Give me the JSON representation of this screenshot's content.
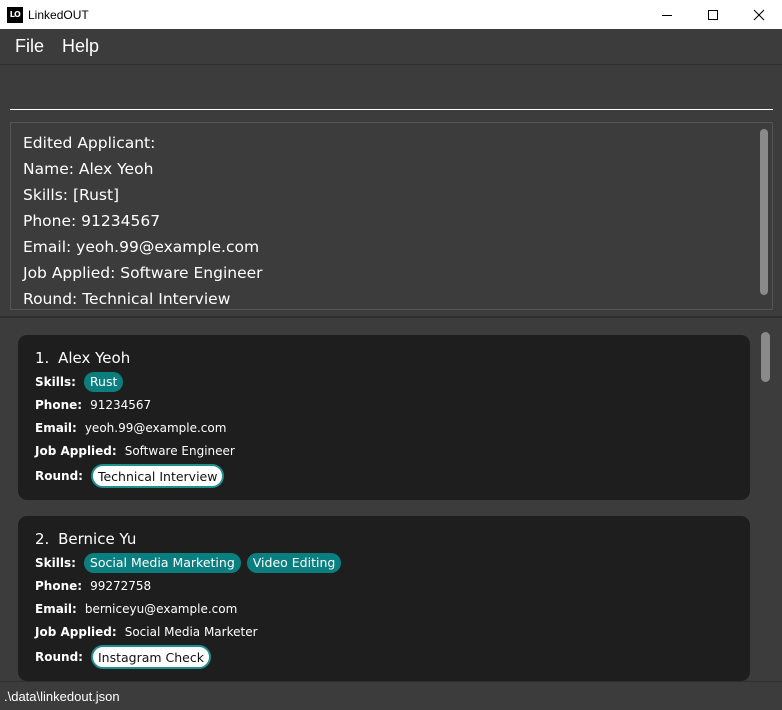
{
  "window": {
    "title": "LinkedOUT",
    "icon_text": "LO"
  },
  "menu": {
    "items": [
      "File",
      "Help"
    ]
  },
  "command": {
    "value": "",
    "placeholder": ""
  },
  "result": {
    "lines": [
      "Edited Applicant:",
      "Name: Alex Yeoh",
      "Skills: [Rust]",
      "Phone: 91234567",
      "Email: yeoh.99@example.com",
      "Job Applied: Software Engineer",
      "Round: Technical Interview"
    ]
  },
  "labels": {
    "skills": "Skills:",
    "phone": "Phone:",
    "email": "Email:",
    "job": "Job Applied:",
    "round": "Round:"
  },
  "applicants": [
    {
      "index": "1.",
      "name": "Alex Yeoh",
      "skills": [
        "Rust"
      ],
      "phone": "91234567",
      "email": "yeoh.99@example.com",
      "job": "Software Engineer",
      "round": "Technical Interview"
    },
    {
      "index": "2.",
      "name": "Bernice Yu",
      "skills": [
        "Social Media Marketing",
        "Video Editing"
      ],
      "phone": "99272758",
      "email": "berniceyu@example.com",
      "job": "Social Media Marketer",
      "round": "Instagram Check"
    }
  ],
  "status": {
    "path": ".\\data\\linkedout.json"
  },
  "colors": {
    "tag": "#0b7f7f",
    "card": "#1e1e1e",
    "background": "#3c3c3c"
  }
}
